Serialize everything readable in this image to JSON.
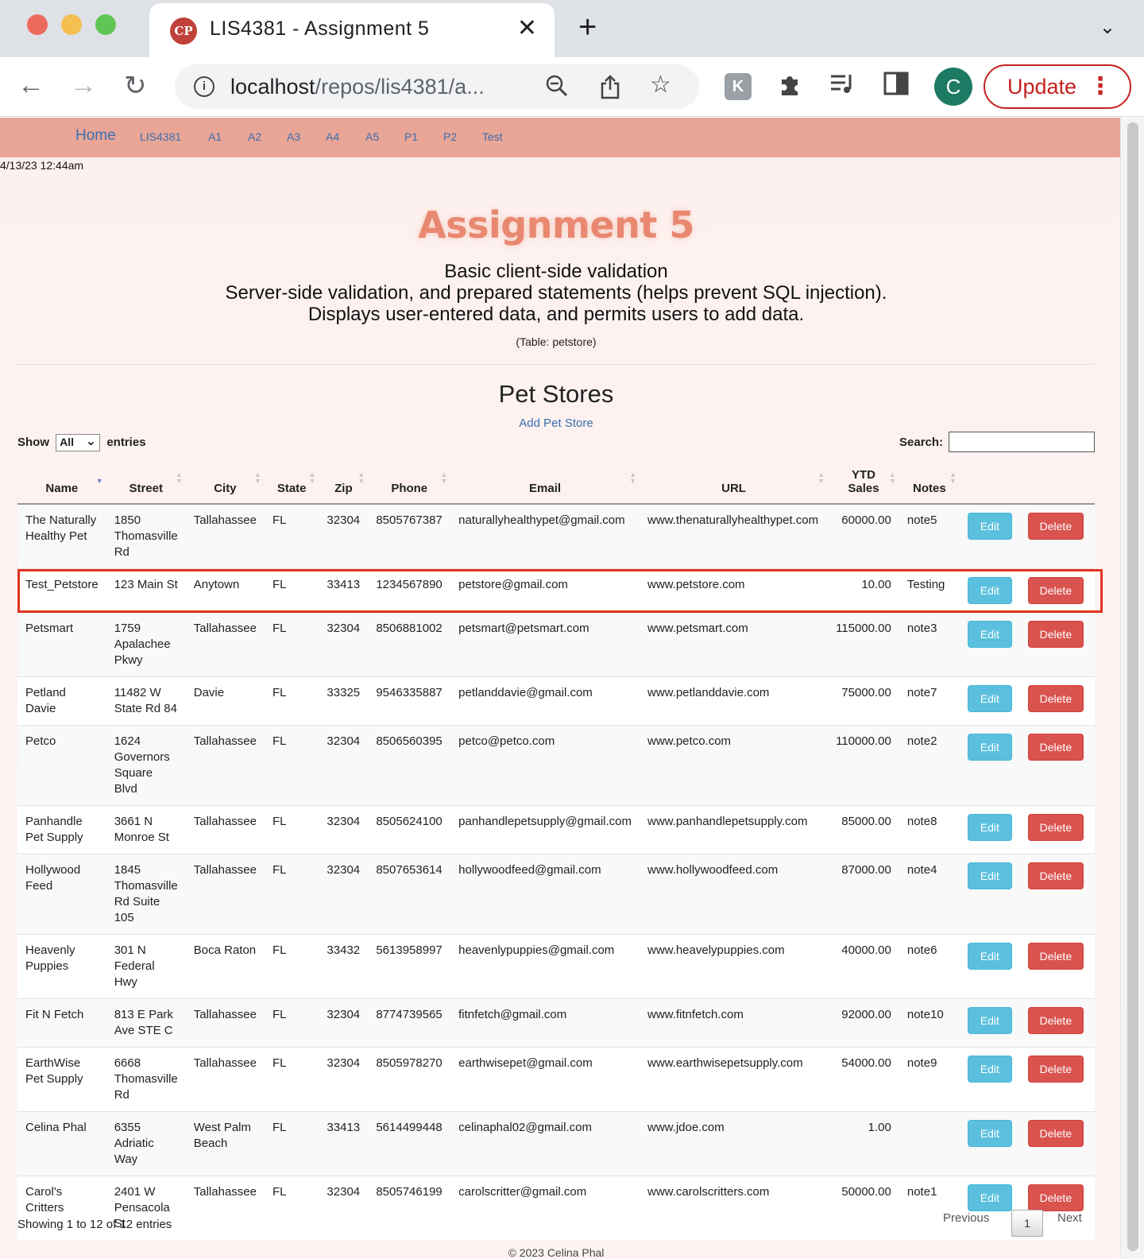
{
  "browser": {
    "tab_title": "LIS4381 - Assignment 5",
    "favicon_text": "CP",
    "url_host": "localhost",
    "url_path": "/repos/lis4381/a...",
    "profile_initial": "C",
    "update_label": "Update",
    "icons": [
      "back-arrow-icon",
      "forward-arrow-icon",
      "reload-icon",
      "info-icon",
      "zoom-out-icon",
      "share-icon",
      "star-icon",
      "extension-k-icon",
      "puzzle-icon",
      "media-queue-icon",
      "sidebar-icon",
      "kebab-menu-icon"
    ]
  },
  "nav": {
    "home": "Home",
    "links": [
      "LIS4381",
      "A1",
      "A2",
      "A3",
      "A4",
      "A5",
      "P1",
      "P2",
      "Test"
    ]
  },
  "datestamp": "4/13/23 12:44am",
  "header": {
    "title": "Assignment 5",
    "line1": "Basic client-side validation",
    "line2": "Server-side validation, and prepared statements (helps prevent SQL injection).",
    "line3": "Displays user-entered data, and permits users to add data.",
    "table_ref": "(Table: petstore)"
  },
  "section": {
    "title": "Pet Stores",
    "add_link": "Add Pet Store"
  },
  "controls": {
    "show_label": "Show",
    "show_value": "All",
    "entries_label": "entries",
    "search_label": "Search:"
  },
  "table": {
    "columns": [
      "Name",
      "Street",
      "City",
      "State",
      "Zip",
      "Phone",
      "Email",
      "URL",
      "YTD Sales",
      "Notes"
    ],
    "edit_label": "Edit",
    "delete_label": "Delete",
    "rows": [
      {
        "name": "The Naturally Healthy Pet",
        "street": "1850 Thomasville Rd",
        "city": "Tallahassee",
        "state": "FL",
        "zip": "32304",
        "phone": "8505767387",
        "email": "naturallyhealthypet@gmail.com",
        "url": "www.thenaturallyhealthypet.com",
        "sales": "60000.00",
        "notes": "note5"
      },
      {
        "name": "Test_Petstore",
        "street": "123 Main St",
        "city": "Anytown",
        "state": "FL",
        "zip": "33413",
        "phone": "1234567890",
        "email": "petstore@gmail.com",
        "url": "www.petstore.com",
        "sales": "10.00",
        "notes": "Testing",
        "highlighted": true
      },
      {
        "name": "Petsmart",
        "street": "1759 Apalachee Pkwy",
        "city": "Tallahassee",
        "state": "FL",
        "zip": "32304",
        "phone": "8506881002",
        "email": "petsmart@petsmart.com",
        "url": "www.petsmart.com",
        "sales": "115000.00",
        "notes": "note3"
      },
      {
        "name": "Petland Davie",
        "street": "11482 W State Rd 84",
        "city": "Davie",
        "state": "FL",
        "zip": "33325",
        "phone": "9546335887",
        "email": "petlanddavie@gmail.com",
        "url": "www.petlanddavie.com",
        "sales": "75000.00",
        "notes": "note7"
      },
      {
        "name": "Petco",
        "street": "1624 Governors Square Blvd",
        "city": "Tallahassee",
        "state": "FL",
        "zip": "32304",
        "phone": "8506560395",
        "email": "petco@petco.com",
        "url": "www.petco.com",
        "sales": "110000.00",
        "notes": "note2"
      },
      {
        "name": "Panhandle Pet Supply",
        "street": "3661 N Monroe St",
        "city": "Tallahassee",
        "state": "FL",
        "zip": "32304",
        "phone": "8505624100",
        "email": "panhandlepetsupply@gmail.com",
        "url": "www.panhandlepetsupply.com",
        "sales": "85000.00",
        "notes": "note8"
      },
      {
        "name": "Hollywood Feed",
        "street": "1845 Thomasville Rd Suite 105",
        "city": "Tallahassee",
        "state": "FL",
        "zip": "32304",
        "phone": "8507653614",
        "email": "hollywoodfeed@gmail.com",
        "url": "www.hollywoodfeed.com",
        "sales": "87000.00",
        "notes": "note4"
      },
      {
        "name": "Heavenly Puppies",
        "street": "301 N Federal Hwy",
        "city": "Boca Raton",
        "state": "FL",
        "zip": "33432",
        "phone": "5613958997",
        "email": "heavenlypuppies@gmail.com",
        "url": "www.heavelypuppies.com",
        "sales": "40000.00",
        "notes": "note6"
      },
      {
        "name": "Fit N Fetch",
        "street": "813 E Park Ave STE C",
        "city": "Tallahassee",
        "state": "FL",
        "zip": "32304",
        "phone": "8774739565",
        "email": "fitnfetch@gmail.com",
        "url": "www.fitnfetch.com",
        "sales": "92000.00",
        "notes": "note10"
      },
      {
        "name": "EarthWise Pet Supply",
        "street": "6668 Thomasville Rd",
        "city": "Tallahassee",
        "state": "FL",
        "zip": "32304",
        "phone": "8505978270",
        "email": "earthwisepet@gmail.com",
        "url": "www.earthwisepetsupply.com",
        "sales": "54000.00",
        "notes": "note9"
      },
      {
        "name": "Celina Phal",
        "street": "6355 Adriatic Way",
        "city": "West Palm Beach",
        "state": "FL",
        "zip": "33413",
        "phone": "5614499448",
        "email": "celinaphal02@gmail.com",
        "url": "www.jdoe.com",
        "sales": "1.00",
        "notes": ""
      },
      {
        "name": "Carol's Critters",
        "street": "2401 W Pensacola St",
        "city": "Tallahassee",
        "state": "FL",
        "zip": "32304",
        "phone": "8505746199",
        "email": "carolscritter@gmail.com",
        "url": "www.carolscritters.com",
        "sales": "50000.00",
        "notes": "note1"
      }
    ]
  },
  "pagination": {
    "info": "Showing 1 to 12 of 12 entries",
    "previous": "Previous",
    "current": "1",
    "next": "Next"
  },
  "footer": "© 2023 Celina Phal",
  "colors": {
    "nav_bg": "#e9a596",
    "title": "#e98870",
    "edit_button": "#5bc0de",
    "delete_button": "#d9534f",
    "highlight_border": "#e2331f",
    "update_button": "#c5221f"
  }
}
